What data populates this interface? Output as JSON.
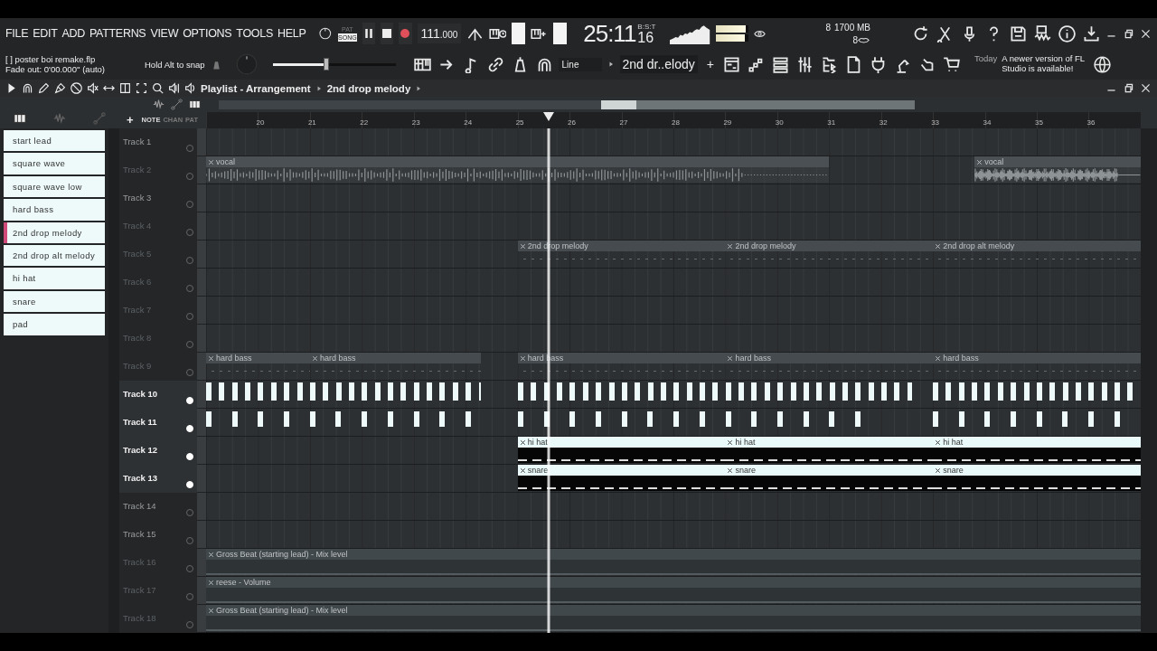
{
  "menu": [
    "FILE",
    "EDIT",
    "ADD",
    "PATTERNS",
    "VIEW",
    "OPTIONS",
    "TOOLS",
    "HELP"
  ],
  "transport": {
    "modes": [
      {
        "label": "PAT",
        "selected": false
      },
      {
        "label": "SONG",
        "selected": true
      }
    ],
    "tempo": "111",
    "tempo_fraction": ".000",
    "time": "25:11",
    "time_ticks": "16",
    "time_unit": "B:S:T"
  },
  "output_meters": [
    {
      "level": 0.92
    },
    {
      "level": 0.9
    }
  ],
  "resources": {
    "cpu": "8",
    "memory": "1700 MB",
    "polyphony": "8"
  },
  "project": {
    "marker": "[ ]",
    "file": "poster boi remake.flp",
    "fade": "Fade out:  0'00.000'' (auto)",
    "hint": "Hold Alt to snap"
  },
  "master_volume": {
    "level": 0.44
  },
  "snap": {
    "value": "Line"
  },
  "pattern_selector": {
    "value": "2nd dr..elody",
    "add": "+"
  },
  "news": {
    "date": "Today",
    "message": "A newer version of FL Studio is available!"
  },
  "playlist": {
    "title": "Playlist - Arrangement",
    "pattern": "2nd drop melody"
  },
  "picker": {
    "add": "+",
    "labels": [
      "NOTE",
      "CHAN",
      "PAT"
    ]
  },
  "patterns": [
    {
      "name": "start lead",
      "selected": false
    },
    {
      "name": "square wave",
      "selected": false
    },
    {
      "name": "square wave low",
      "selected": false
    },
    {
      "name": "hard bass",
      "selected": false
    },
    {
      "name": "2nd drop melody",
      "selected": true
    },
    {
      "name": "2nd drop alt melody",
      "selected": false
    },
    {
      "name": "hi hat",
      "selected": false
    },
    {
      "name": "snare",
      "selected": false
    },
    {
      "name": "pad",
      "selected": false
    }
  ],
  "ruler": [
    "20",
    "21",
    "22",
    "23",
    "24",
    "25",
    "26",
    "27",
    "28",
    "29",
    "30",
    "31",
    "32",
    "33",
    "34",
    "35",
    "36"
  ],
  "playhead": {
    "level": 0.367
  },
  "tracks": [
    {
      "name": "Track 1",
      "selected": false,
      "dimmed": false
    },
    {
      "name": "Track 2",
      "selected": false,
      "dimmed": true,
      "clips": [
        {
          "kind": "audio",
          "label": "vocal"
        },
        {
          "kind": "audio",
          "label": "vocal"
        }
      ]
    },
    {
      "name": "Track 3",
      "selected": false,
      "dimmed": false
    },
    {
      "name": "Track 4",
      "selected": false,
      "dimmed": true
    },
    {
      "name": "Track 5",
      "selected": false,
      "dimmed": true,
      "clips": [
        {
          "kind": "pattern",
          "label": "2nd drop melody"
        },
        {
          "kind": "pattern",
          "label": "2nd drop melody"
        },
        {
          "kind": "pattern",
          "label": "2nd drop alt melody"
        }
      ]
    },
    {
      "name": "Track 6",
      "selected": false,
      "dimmed": true
    },
    {
      "name": "Track 7",
      "selected": false,
      "dimmed": true
    },
    {
      "name": "Track 8",
      "selected": false,
      "dimmed": true
    },
    {
      "name": "Track 9",
      "selected": false,
      "dimmed": true,
      "clips": [
        {
          "kind": "pattern",
          "label": "hard bass"
        },
        {
          "kind": "pattern",
          "label": "hard bass"
        },
        {
          "kind": "pattern",
          "label": "hard bass"
        },
        {
          "kind": "pattern",
          "label": "hard bass"
        },
        {
          "kind": "pattern",
          "label": "hard bass"
        }
      ]
    },
    {
      "name": "Track 10",
      "selected": true,
      "dimmed": false,
      "clips": [
        {
          "kind": "notes"
        },
        {
          "kind": "notes"
        },
        {
          "kind": "notes"
        }
      ]
    },
    {
      "name": "Track 11",
      "selected": true,
      "dimmed": false,
      "clips": [
        {
          "kind": "sparse-notes"
        },
        {
          "kind": "sparse-notes"
        },
        {
          "kind": "sparse-notes"
        }
      ]
    },
    {
      "name": "Track 12",
      "selected": true,
      "dimmed": false,
      "clips": [
        {
          "kind": "drum",
          "label": "hi hat"
        },
        {
          "kind": "drum",
          "label": "hi hat"
        },
        {
          "kind": "drum",
          "label": "hi hat"
        }
      ]
    },
    {
      "name": "Track 13",
      "selected": true,
      "dimmed": false,
      "clips": [
        {
          "kind": "drum",
          "label": "snare"
        },
        {
          "kind": "drum",
          "label": "snare"
        },
        {
          "kind": "drum",
          "label": "snare"
        }
      ]
    },
    {
      "name": "Track 14",
      "selected": false,
      "dimmed": false
    },
    {
      "name": "Track 15",
      "selected": false,
      "dimmed": false
    },
    {
      "name": "Track 16",
      "selected": false,
      "dimmed": true,
      "clips": [
        {
          "kind": "automation",
          "label": "Gross Beat (starting lead) - Mix level"
        }
      ]
    },
    {
      "name": "Track 17",
      "selected": false,
      "dimmed": true,
      "clips": [
        {
          "kind": "automation",
          "label": "reese - Volume"
        }
      ]
    },
    {
      "name": "Track 18",
      "selected": false,
      "dimmed": true,
      "clips": [
        {
          "kind": "automation",
          "label": "Gross Beat (starting lead) - Mix level"
        }
      ]
    }
  ]
}
